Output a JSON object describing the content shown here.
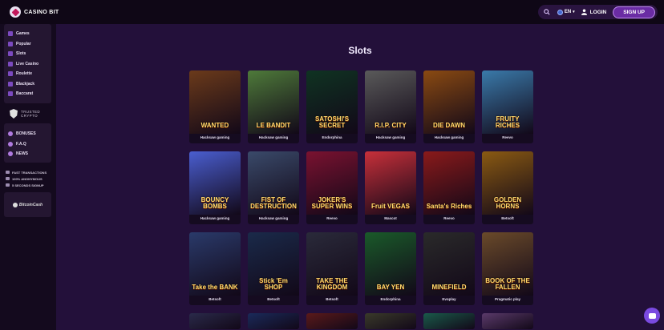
{
  "header": {
    "brand": "CASINO BIT",
    "language": "EN",
    "login_label": "LOGIN",
    "signup_label": "SIGN UP"
  },
  "sidebar": {
    "nav": [
      {
        "label": "Games",
        "icon": "gamepad-icon"
      },
      {
        "label": "Popular",
        "icon": "star-icon"
      },
      {
        "label": "Slots",
        "icon": "slot-icon"
      },
      {
        "label": "Live Casino",
        "icon": "live-icon"
      },
      {
        "label": "Roulette",
        "icon": "roulette-icon"
      },
      {
        "label": "Blackjack",
        "icon": "cards-icon"
      },
      {
        "label": "Baccarat",
        "icon": "chip-icon"
      }
    ],
    "trusted_line1": "TRUSTED",
    "trusted_line2": "CRYPTO",
    "info": [
      {
        "label": "BONUSES",
        "icon": "gift-icon"
      },
      {
        "label": "F.A.Q",
        "icon": "question-icon"
      },
      {
        "label": "NEWS",
        "icon": "news-icon"
      }
    ],
    "features": [
      "FAST TRANSACTIONS",
      "100% ANONYMOUS",
      "5 SECONDS SIGNUP"
    ],
    "bitcoin_cash": "BitcoinCash"
  },
  "main": {
    "title": "Slots",
    "games": [
      {
        "name": "WANTED",
        "provider": "Hacksaw gaming",
        "color": "#6b3a1a"
      },
      {
        "name": "LE BANDIT",
        "provider": "Hacksaw gaming",
        "color": "#4e7a3a"
      },
      {
        "name": "SATOSHI'S SECRET",
        "provider": "Endorphina",
        "color": "#0f3322"
      },
      {
        "name": "R.I.P. CITY",
        "provider": "Hacksaw gaming",
        "color": "#5a5a5a"
      },
      {
        "name": "DIE DAWN",
        "provider": "Hacksaw gaming",
        "color": "#8a4a12"
      },
      {
        "name": "FRUITY RICHES",
        "provider": "Reevo",
        "color": "#3a7aaa"
      },
      {
        "name": "BOUNCY BOMBS",
        "provider": "Hacksaw gaming",
        "color": "#4a5ed0"
      },
      {
        "name": "FIST OF DESTRUCTION",
        "provider": "Hacksaw gaming",
        "color": "#3a4a6a"
      },
      {
        "name": "JOKER'S SUPER WINS",
        "provider": "Reevo",
        "color": "#7a1230"
      },
      {
        "name": "Fruit VEGAS",
        "provider": "Mascot",
        "color": "#c8303a"
      },
      {
        "name": "Santa's Riches",
        "provider": "Reevo",
        "color": "#8a1a1a"
      },
      {
        "name": "GOLDEN HORNS",
        "provider": "Betsoft",
        "color": "#8a5a12"
      },
      {
        "name": "Take the BANK",
        "provider": "Betsoft",
        "color": "#2a3a6a"
      },
      {
        "name": "Stick 'Em SHOP",
        "provider": "Betsoft",
        "color": "#1a2a4a"
      },
      {
        "name": "TAKE THE KINGDOM",
        "provider": "Betsoft",
        "color": "#2a2a3a"
      },
      {
        "name": "BAY YEN",
        "provider": "Endorphina",
        "color": "#1a5a2a"
      },
      {
        "name": "MINEFIELD",
        "provider": "Evoplay",
        "color": "#2a2a2a"
      },
      {
        "name": "BOOK OF THE FALLEN",
        "provider": "Pragmatic play",
        "color": "#6a4a2a"
      }
    ],
    "next_row_colors": [
      "#2a2a4a",
      "#1a2a5a",
      "#5a1a1a",
      "#3a3a2a",
      "#1a5a4a",
      "#5a3a6a"
    ]
  }
}
